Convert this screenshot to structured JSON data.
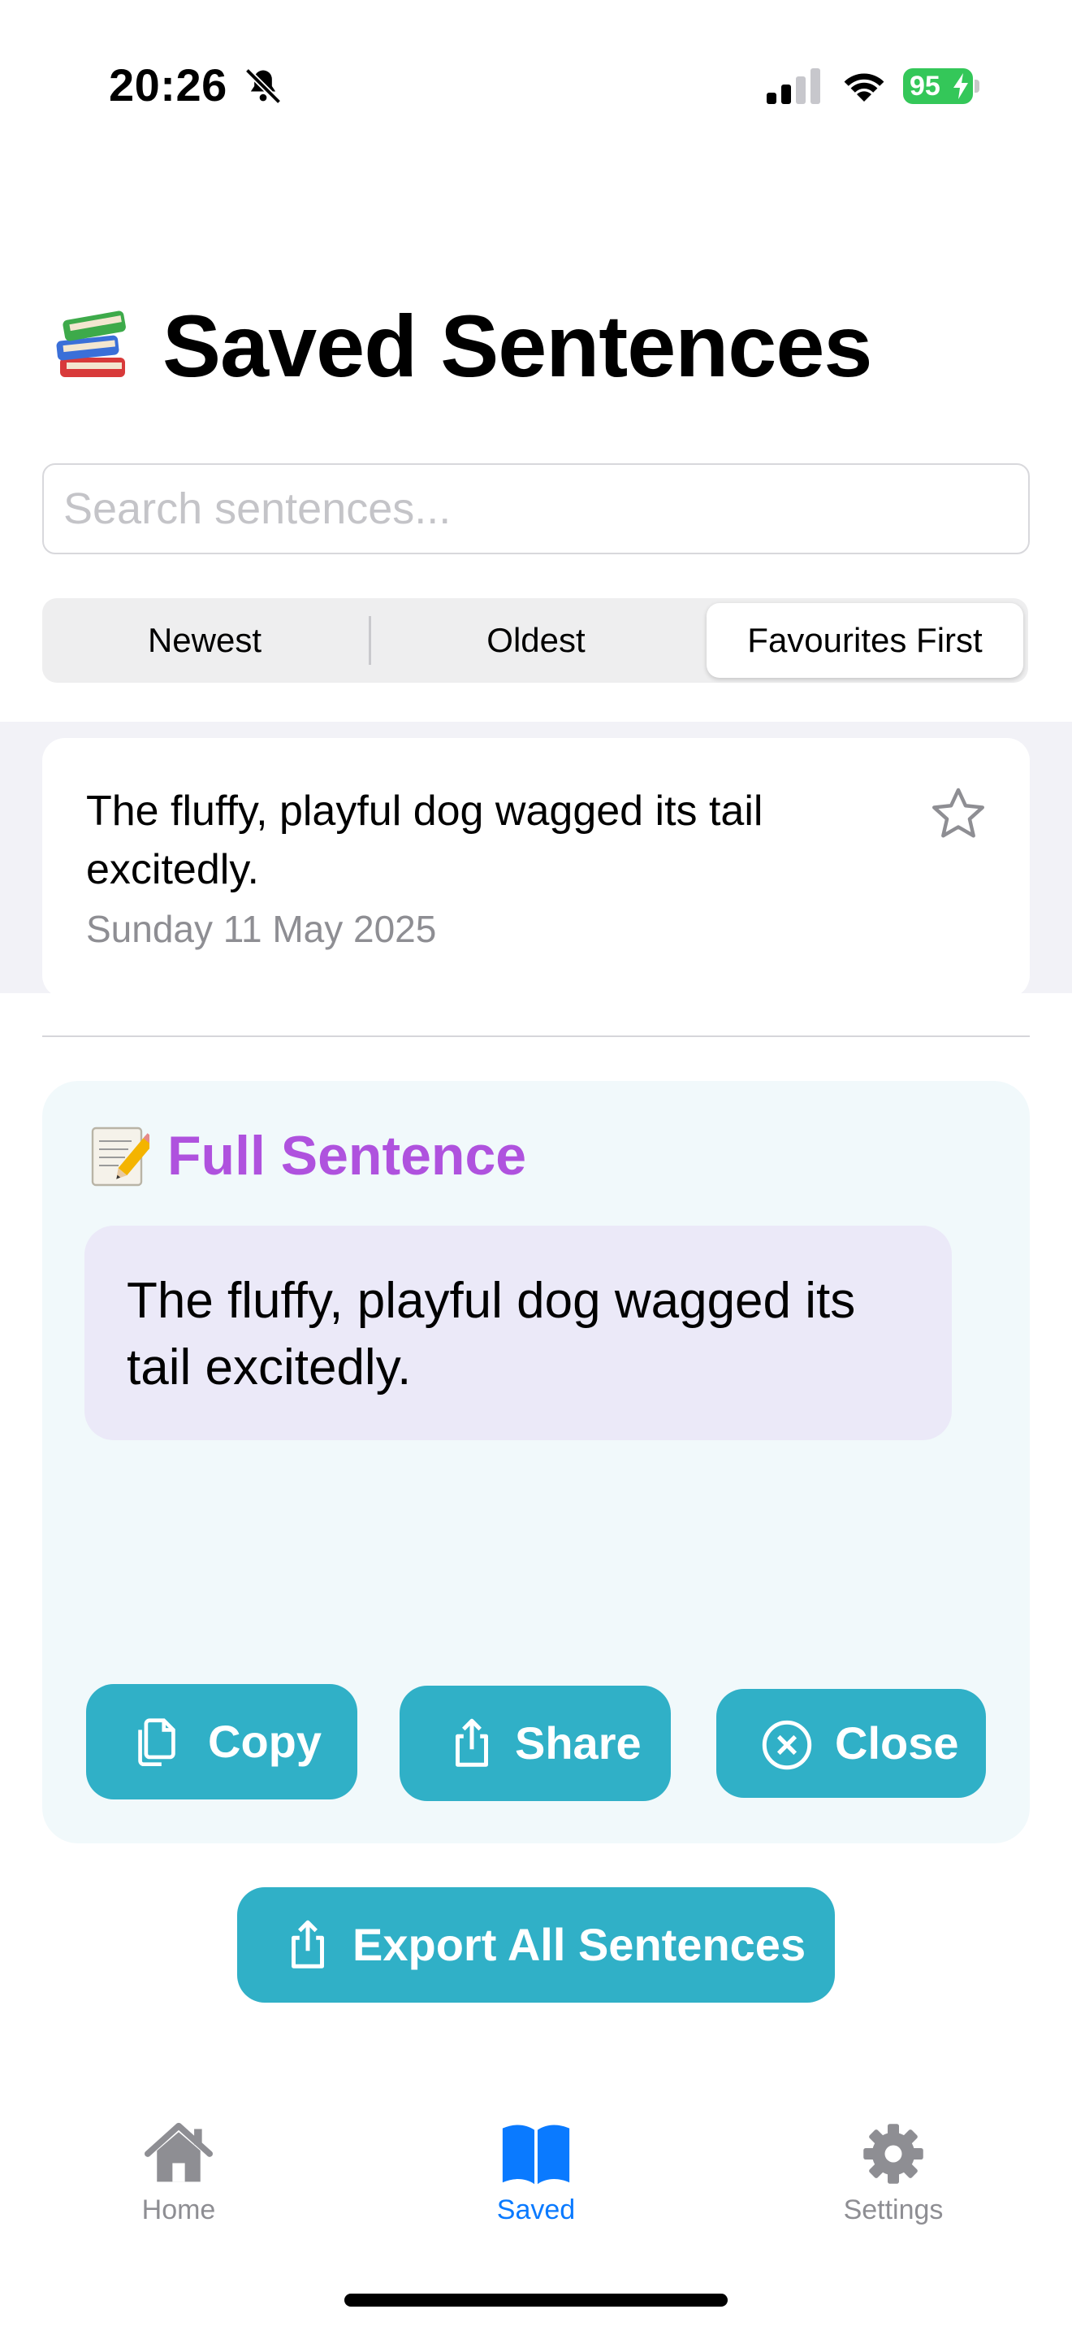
{
  "status_bar": {
    "time": "20:26",
    "battery": "95"
  },
  "header": {
    "title": "Saved Sentences",
    "icon": "books-icon"
  },
  "search": {
    "placeholder": "Search sentences..."
  },
  "sort": {
    "options": [
      "Newest",
      "Oldest",
      "Favourites First"
    ],
    "selected": "Favourites First"
  },
  "sentences": [
    {
      "text": "The fluffy, playful dog wagged its tail excitedly.",
      "date": "Sunday 11 May 2025",
      "favourite": false
    }
  ],
  "detail": {
    "title": "Full Sentence",
    "icon": "memo-icon",
    "text": "The fluffy, playful dog wagged its tail excitedly.",
    "copy_label": "Copy",
    "share_label": "Share",
    "close_label": "Close"
  },
  "export_label": "Export All Sentences",
  "tabs": [
    {
      "label": "Home",
      "icon": "house-icon",
      "active": false
    },
    {
      "label": "Saved",
      "icon": "book-icon",
      "active": true
    },
    {
      "label": "Settings",
      "icon": "gear-icon",
      "active": false
    }
  ],
  "colors": {
    "accent": "#30b0c7",
    "title_purple": "#af52de",
    "tab_active": "#0a7aff",
    "battery_green": "#34c759"
  }
}
